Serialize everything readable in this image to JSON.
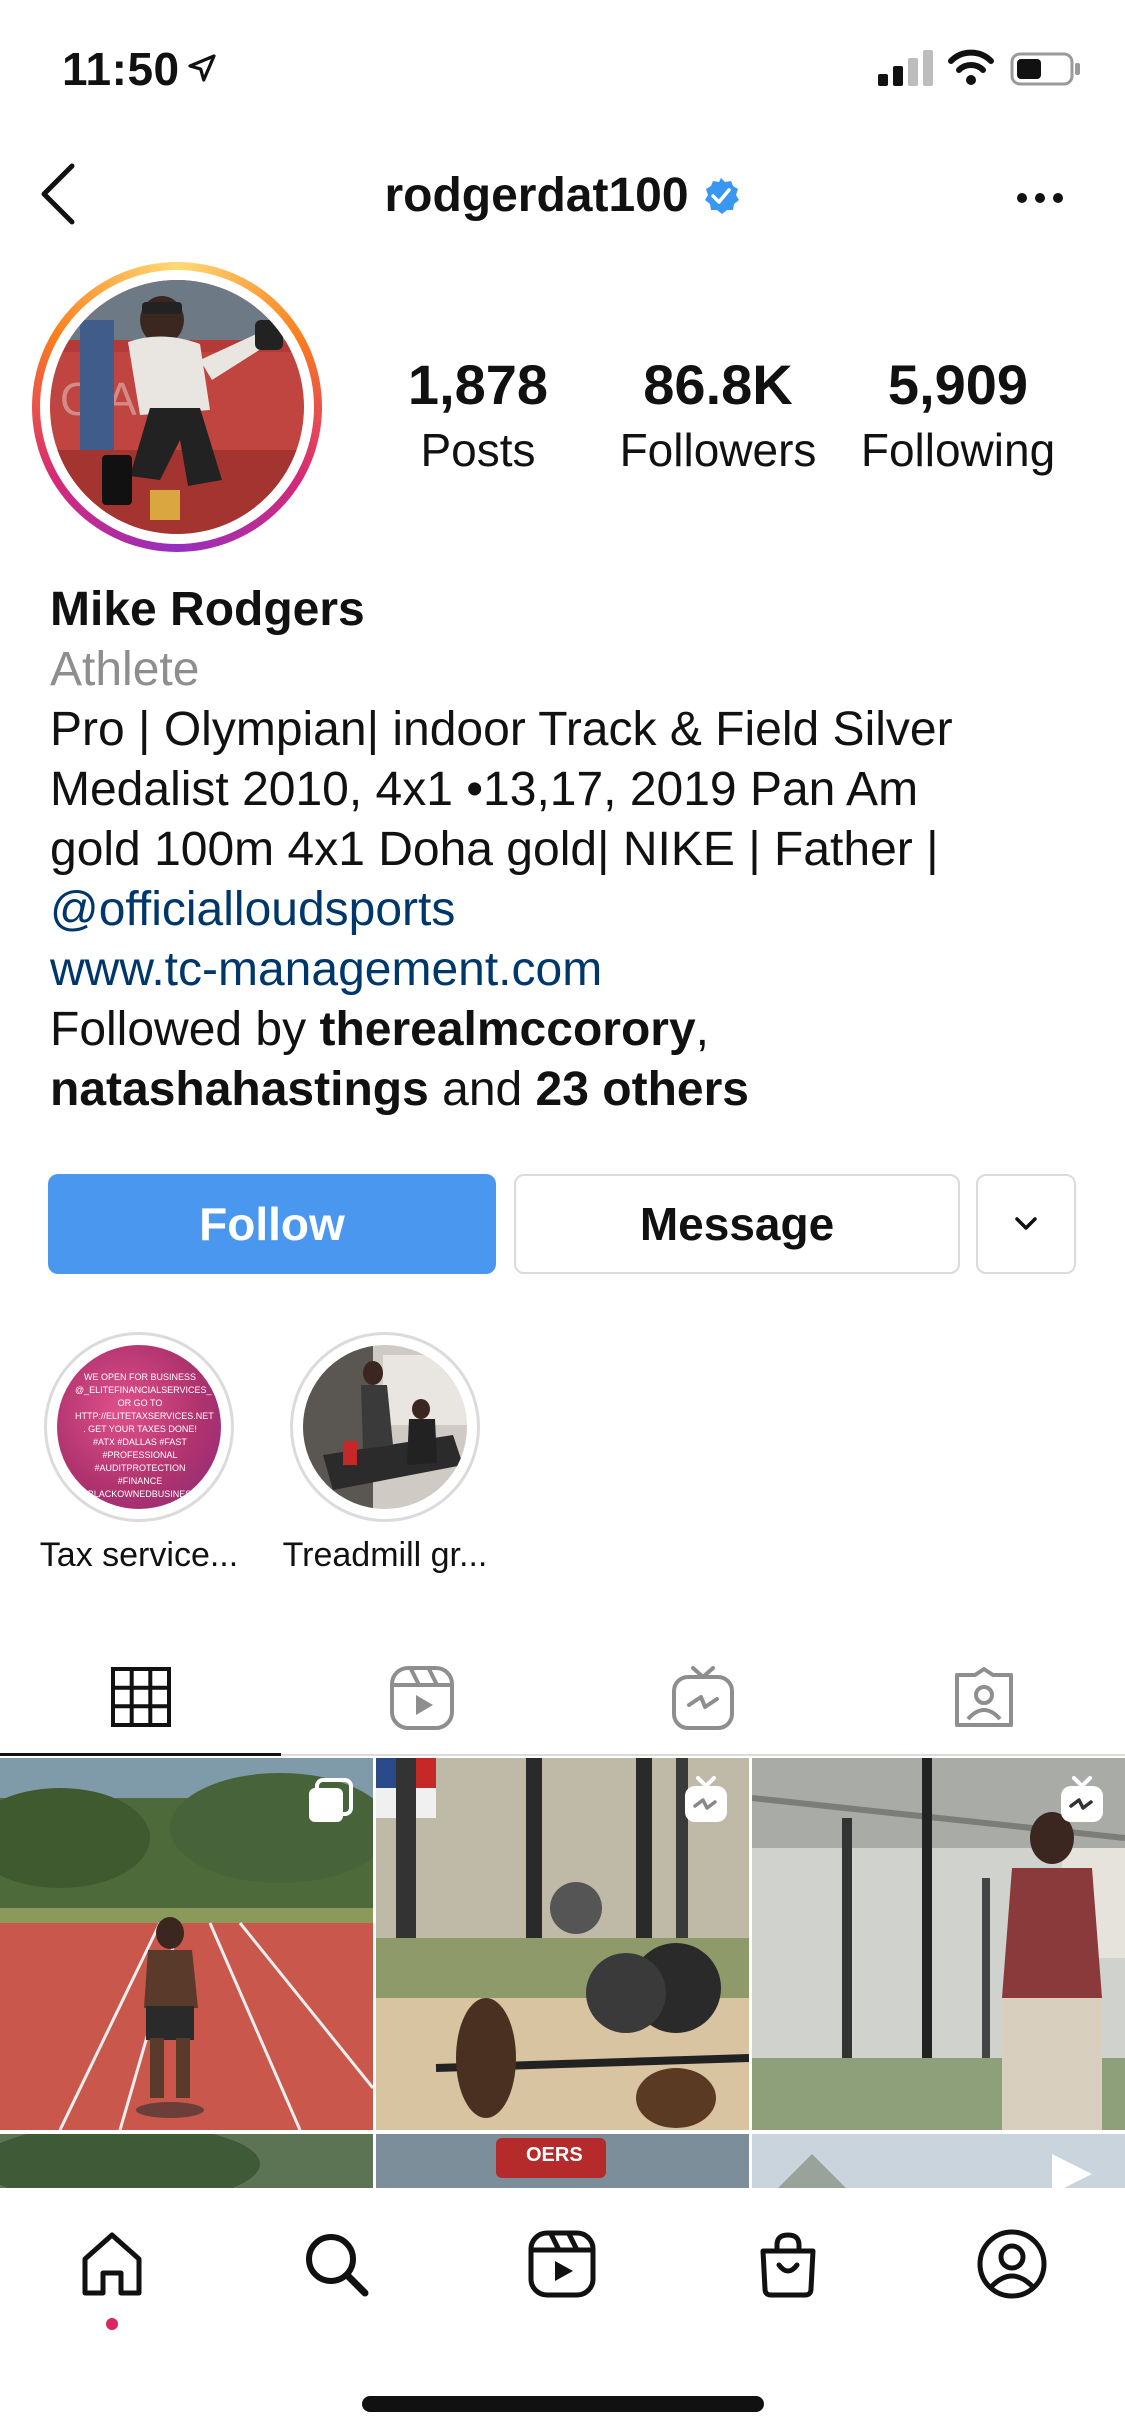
{
  "status_bar": {
    "time": "11:50",
    "icons": [
      "location-arrow-icon",
      "signal-icon",
      "wifi-icon",
      "battery-icon"
    ]
  },
  "header": {
    "username": "rodgerdat100",
    "verified": true,
    "back_icon": "chevron-left-icon",
    "more_icon": "ellipsis-icon"
  },
  "profile": {
    "stats": [
      {
        "value": "1,878",
        "label": "Posts"
      },
      {
        "value": "86.8K",
        "label": "Followers"
      },
      {
        "value": "5,909",
        "label": "Following"
      }
    ],
    "name": "Mike Rodgers",
    "category": "Athlete",
    "bio_line1": "Pro  | Olympian| indoor Track & Field Silver",
    "bio_line2": "Medalist 2010, 4x1 •13,17, 2019 Pan Am",
    "bio_line3": "gold 100m 4x1 Doha gold| NIKE | Father |",
    "bio_mention": "@officialloudsports",
    "website": "www.tc-management.com",
    "followed_by_prefix": "Followed by ",
    "followed_by_user1": "therealmccorory",
    "followed_by_sep": ",",
    "followed_by_user2": "natashahastings",
    "followed_by_and": " and ",
    "followed_by_others": "23 others"
  },
  "actions": {
    "follow_label": "Follow",
    "message_label": "Message",
    "more_icon": "chevron-down-icon"
  },
  "highlights": [
    {
      "label": "Tax service...",
      "image_text": "WE OPEN FOR BUSINESS @_ELITEFINANCIALSERVICES_ OR GO TO HTTP://ELITETAXSERVICES.NET . GET YOUR TAXES DONE! #ATX #DALLAS #FAST #PROFESSIONAL #AUDITPROTECTION #FINANCE #BLACKOWNEDBUSINESS"
    },
    {
      "label": "Treadmill gr..."
    }
  ],
  "tabs": [
    {
      "name": "grid",
      "icon": "grid-icon",
      "active": true
    },
    {
      "name": "reels",
      "icon": "reels-icon",
      "active": false
    },
    {
      "name": "igtv",
      "icon": "igtv-icon",
      "active": false
    },
    {
      "name": "tagged",
      "icon": "tagged-icon",
      "active": false
    }
  ],
  "grid_posts": [
    {
      "type": "carousel",
      "icon": "carousel-icon"
    },
    {
      "type": "igtv",
      "icon": "igtv-icon"
    },
    {
      "type": "igtv",
      "icon": "igtv-icon"
    }
  ],
  "grid_partial_text": "OERS",
  "bottom_nav": [
    {
      "name": "home",
      "icon": "home-icon",
      "active": true
    },
    {
      "name": "search",
      "icon": "search-icon"
    },
    {
      "name": "reels",
      "icon": "reels-icon"
    },
    {
      "name": "shop",
      "icon": "shop-icon"
    },
    {
      "name": "profile",
      "icon": "profile-icon"
    }
  ],
  "colors": {
    "follow_button": "#4a97ef",
    "link": "#00376b",
    "category": "#8e8e8e",
    "verified": "#3897f0",
    "notification_dot": "#e0245e"
  }
}
